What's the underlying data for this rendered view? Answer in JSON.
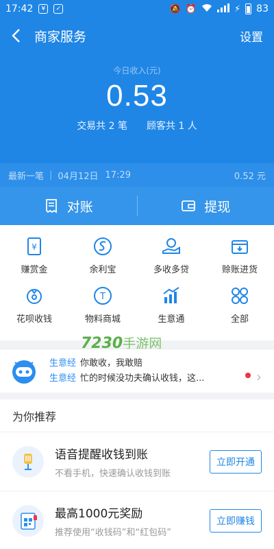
{
  "status_bar": {
    "time": "17:42",
    "battery": "83",
    "network": "4G"
  },
  "nav": {
    "title": "商家服务",
    "settings_label": "设置"
  },
  "income": {
    "label": "今日收入(元)",
    "amount": "0.53",
    "transactions": "交易共 2 笔",
    "customers": "顾客共 1 人"
  },
  "latest": {
    "label": "最新一笔",
    "date": "04月12日",
    "time": "17:29",
    "amount": "0.52 元"
  },
  "actions": [
    {
      "label": "对账",
      "icon": "receipt-icon"
    },
    {
      "label": "提现",
      "icon": "wallet-icon"
    }
  ],
  "services": [
    {
      "label": "赚赏金",
      "icon": "reward-icon"
    },
    {
      "label": "余利宝",
      "icon": "yulibao-icon"
    },
    {
      "label": "多收多贷",
      "icon": "loan-icon"
    },
    {
      "label": "赊账进货",
      "icon": "credit-stock-icon"
    },
    {
      "label": "花呗收钱",
      "icon": "huabei-icon"
    },
    {
      "label": "物料商城",
      "icon": "material-store-icon"
    },
    {
      "label": "生意通",
      "icon": "business-chart-icon"
    },
    {
      "label": "全部",
      "icon": "all-grid-icon"
    }
  ],
  "watermark": {
    "number": "7230",
    "text": "手游网"
  },
  "news": [
    {
      "tag": "生意经",
      "text": "你敢收，我敢赔"
    },
    {
      "tag": "生意经",
      "text": "忙的时候没功夫确认收钱，这..."
    }
  ],
  "recommendations": {
    "header": "为你推荐",
    "items": [
      {
        "title": "语音提醒收钱到账",
        "subtitle": "不看手机，快速确认收钱到账",
        "button": "立即开通"
      },
      {
        "title": "最高1000元奖励",
        "subtitle": "推荐使用“收钱码”和“红包码”",
        "button": "立即赚钱"
      }
    ]
  },
  "colors": {
    "primary": "#1f86e6",
    "accent_red": "#f0343f"
  }
}
